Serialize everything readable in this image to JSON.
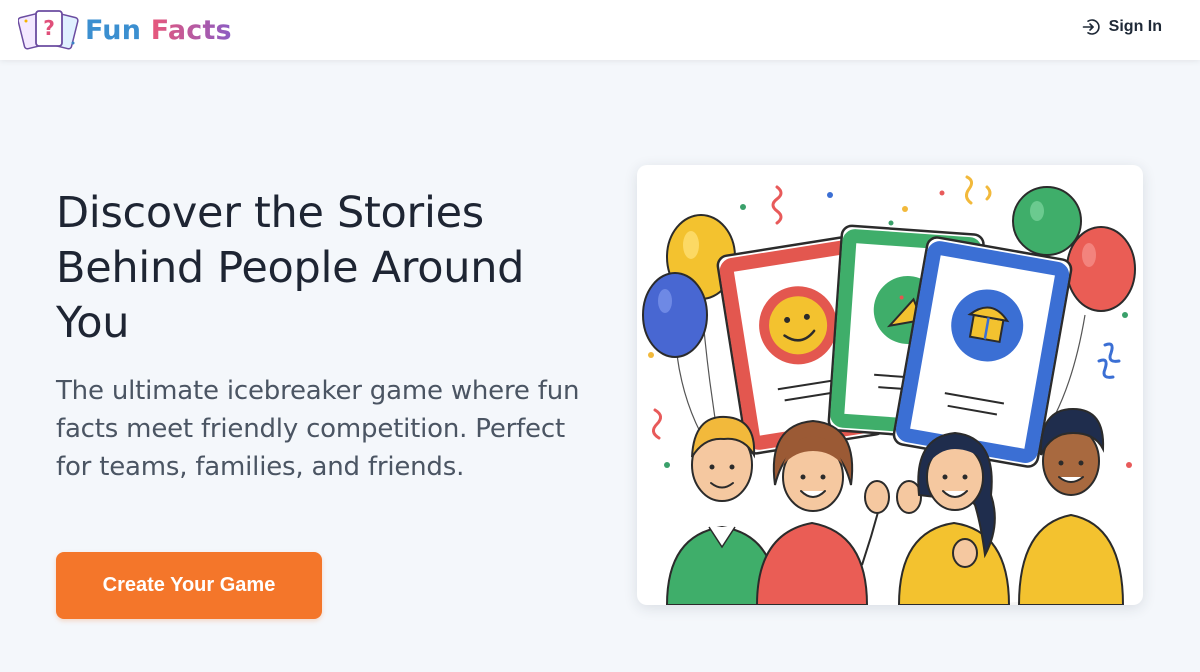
{
  "header": {
    "brand_word_1": "Fun",
    "brand_word_2": "Facts",
    "logo_icon": "question-cards-icon",
    "signin_icon": "sign-in-icon",
    "signin_label": "Sign In"
  },
  "hero": {
    "title": "Discover the Stories Behind People Around You",
    "subtitle": "The ultimate icebreaker game where fun facts meet friendly competition. Perfect for teams, families, and friends.",
    "cta_label": "Create Your Game"
  },
  "illustration": {
    "description_icon": "people-cards-balloons-illustration"
  },
  "colors": {
    "accent_orange": "#f4762a",
    "brand_blue": "#3b82c4",
    "brand_pink": "#e0507a",
    "brand_purple": "#8b5cc4",
    "page_bg": "#f4f7fb"
  }
}
